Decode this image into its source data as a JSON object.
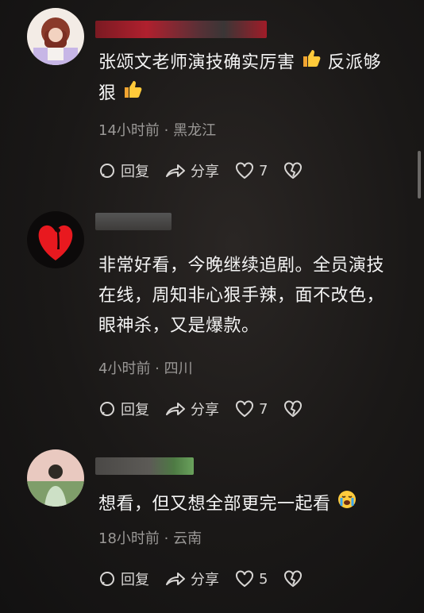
{
  "comments": [
    {
      "text_line1": "张颂文老师演技确实厉害",
      "text_line2a": "反派够",
      "text_line2b": "狠",
      "meta": "14小时前 · 黑龙江",
      "reply_label": "回复",
      "share_label": "分享",
      "likes": "7"
    },
    {
      "text_line1": "非常好看，今晚继续追剧。全员演技",
      "text_line2": "在线，周知非心狠手辣，面不改色，",
      "text_line3": "眼神杀，又是爆款。",
      "meta": "4小时前 · 四川",
      "reply_label": "回复",
      "share_label": "分享",
      "likes": "7"
    },
    {
      "text_line1": "想看，但又想全部更完一起看",
      "meta": "18小时前 · 云南",
      "reply_label": "回复",
      "share_label": "分享",
      "likes": "5"
    }
  ],
  "icons": {
    "reply": "reply-bubble-icon",
    "share": "share-arrow-icon",
    "like": "heart-icon",
    "dislike": "broken-heart-icon",
    "thumbs_up": "thumbs-up-emoji",
    "crying": "crying-face-emoji"
  }
}
